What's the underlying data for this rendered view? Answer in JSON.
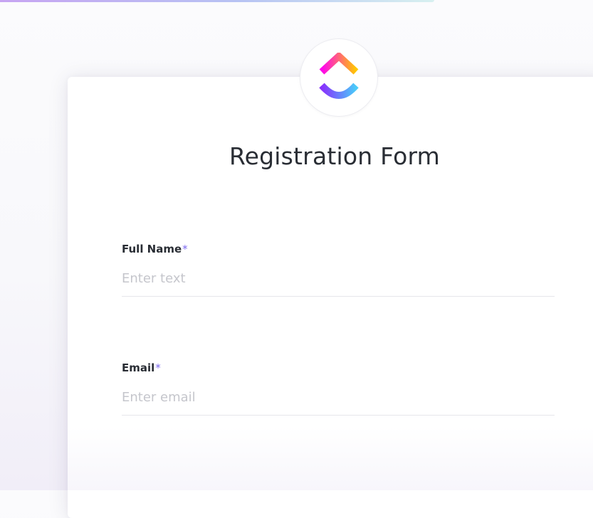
{
  "colors": {
    "accent": "#7b68ee",
    "text": "#292d34",
    "placeholder": "#c5c6cc",
    "logo_top_left": "#ff02f0",
    "logo_top_right": "#ffc800",
    "logo_bottom_left": "#8930fd",
    "logo_bottom_right": "#49ccf9"
  },
  "logo": {
    "icon": "clickup-logo-icon"
  },
  "form": {
    "title": "Registration Form",
    "fields": [
      {
        "label": "Full Name",
        "required_mark": "*",
        "placeholder": "Enter text",
        "value": ""
      },
      {
        "label": "Email",
        "required_mark": "*",
        "placeholder": "Enter email",
        "value": ""
      }
    ]
  }
}
